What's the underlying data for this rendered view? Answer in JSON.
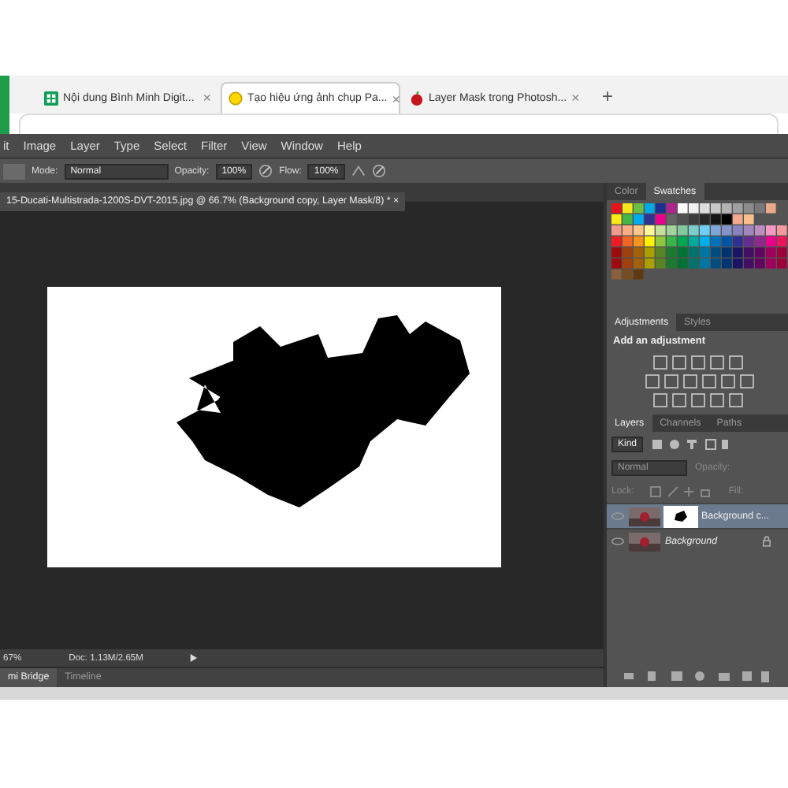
{
  "browser_tabs": [
    {
      "title": "Nội dung Bình Minh Digit...",
      "close": "×",
      "selected": false
    },
    {
      "title": "Tạo hiệu ứng ảnh chụp Pa...",
      "close": "×",
      "selected": true
    },
    {
      "title": "Layer Mask trong Photosh...",
      "close": "×",
      "selected": false
    }
  ],
  "new_tab": "+",
  "menu": [
    "it",
    "Image",
    "Layer",
    "Type",
    "Select",
    "Filter",
    "View",
    "Window",
    "Help"
  ],
  "options": {
    "mode_label": "Mode:",
    "mode": "Normal",
    "opacity_label": "Opacity:",
    "opacity": "100%",
    "flow_label": "Flow:",
    "flow": "100%"
  },
  "document_tab": {
    "title": "15-Ducati-Multistrada-1200S-DVT-2015.jpg @ 66.7% (Background copy, Layer Mask/8) *",
    "close": "×"
  },
  "color_tabs": [
    {
      "label": "Color",
      "selected": false
    },
    {
      "label": "Swatches",
      "selected": true
    }
  ],
  "adjustment_tabs": [
    {
      "label": "Adjustments",
      "selected": true
    },
    {
      "label": "Styles",
      "selected": false
    }
  ],
  "adjustment_heading": "Add an adjustment",
  "layer_tabs": [
    {
      "label": "Layers",
      "selected": true
    },
    {
      "label": "Channels",
      "selected": false
    },
    {
      "label": "Paths",
      "selected": false
    }
  ],
  "layers_panel": {
    "filter": "Kind",
    "blend_mode": "Normal",
    "opacity_label": "Opacity:",
    "lock_label": "Lock:",
    "fill_label": "Fill:"
  },
  "layers": [
    {
      "name": "Background c...",
      "selected": true,
      "has_mask": true,
      "locked": false
    },
    {
      "name": "Background",
      "selected": false,
      "has_mask": false,
      "locked": true
    }
  ],
  "status_bar": {
    "zoom": "67%",
    "doc": "Doc: 1.13M/2.65M"
  },
  "bottom_tabs": [
    {
      "label": "mi Bridge",
      "selected": true
    },
    {
      "label": "Timeline",
      "selected": false
    }
  ]
}
